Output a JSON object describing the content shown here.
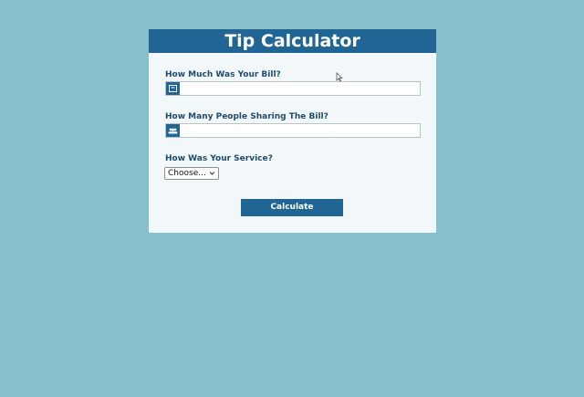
{
  "app": {
    "title": "Tip Calculator"
  },
  "bill": {
    "label": "How Much Was Your Bill?",
    "icon": "bill-icon",
    "value": "",
    "placeholder": ""
  },
  "people": {
    "label": "How Many People Sharing The Bill?",
    "icon": "people-icon",
    "value": "",
    "placeholder": ""
  },
  "service": {
    "label": "How Was Your Service?",
    "selected": "Choose..."
  },
  "actions": {
    "calculate_label": "Calculate"
  },
  "colors": {
    "background": "#86c0cc",
    "card": "#f2f7f9",
    "accent": "#216594",
    "label_text": "#1e4a6e"
  }
}
